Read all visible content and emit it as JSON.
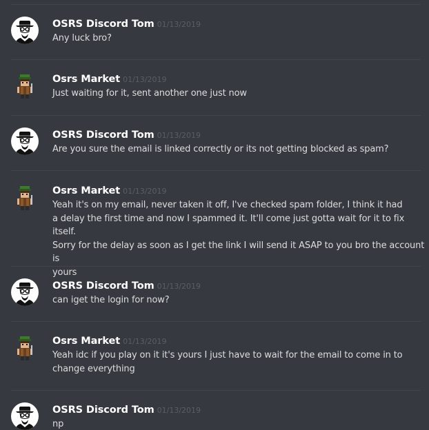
{
  "messages": [
    {
      "author": "OSRS Discord Tom",
      "timestamp": "01/13/2019",
      "text": "Any luck bro?",
      "avatar": "heisenberg-avatar"
    },
    {
      "author": "Osrs Market",
      "timestamp": "01/13/2019",
      "text": "Just waiting for it, sent another one just now",
      "avatar": "pixel-character-avatar"
    },
    {
      "author": "OSRS Discord Tom",
      "timestamp": "01/13/2019",
      "text": "Are you sure the email is linked correctly or its not getting blocked as spam?",
      "avatar": "heisenberg-avatar"
    },
    {
      "author": "Osrs Market",
      "timestamp": "01/13/2019",
      "lines": [
        "Yeah it's on my email, never taken it off, I've checked spam folder, I think it had",
        "a delay the first time and now I spammed it. It'll come just gotta wait for it to fix itself.",
        "Sorry for the delay as soon as I get the link I will send it ASAP to you bro the account is",
        "yours"
      ],
      "avatar": "pixel-character-avatar"
    },
    {
      "author": "OSRS Discord Tom",
      "timestamp": "01/13/2019",
      "text": "can iget the login for now?",
      "avatar": "heisenberg-avatar"
    },
    {
      "author": "Osrs Market",
      "timestamp": "01/13/2019",
      "lines": [
        "Yeah idc if you play on it it's yours I just have to wait for the email to come in to",
        "change everything"
      ],
      "avatar": "pixel-character-avatar"
    },
    {
      "author": "OSRS Discord Tom",
      "timestamp": "01/13/2019",
      "text": "np",
      "avatar": "heisenberg-avatar"
    }
  ],
  "colors": {
    "background": "#36393f",
    "username": "#ffffff",
    "timestamp": "#5b5e63",
    "message_text": "#dcddde",
    "divider": "#42454a"
  }
}
